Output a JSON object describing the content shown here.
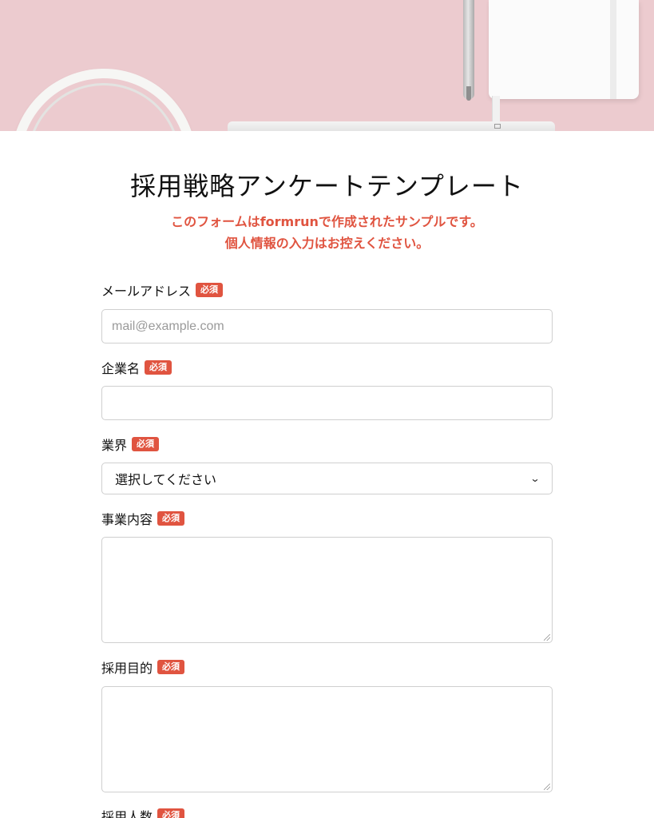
{
  "form": {
    "title": "採用戦略アンケートテンプレート",
    "notice_line1": "このフォームはformrunで作成されたサンプルです。",
    "notice_line2": "個人情報の入力はお控えください。",
    "required_badge": "必須",
    "fields": [
      {
        "label": "メールアドレス",
        "type": "email",
        "placeholder": "mail@example.com",
        "value": ""
      },
      {
        "label": "企業名",
        "type": "text",
        "placeholder": "",
        "value": ""
      },
      {
        "label": "業界",
        "type": "select",
        "selected": "選択してください"
      },
      {
        "label": "事業内容",
        "type": "textarea",
        "value": ""
      },
      {
        "label": "採用目的",
        "type": "textarea",
        "value": ""
      },
      {
        "label": "採用人数",
        "type": "text",
        "value": ""
      }
    ]
  },
  "colors": {
    "accent": "#e05440",
    "border": "#cfcfcf",
    "hero_bg": "#eccbcf"
  }
}
